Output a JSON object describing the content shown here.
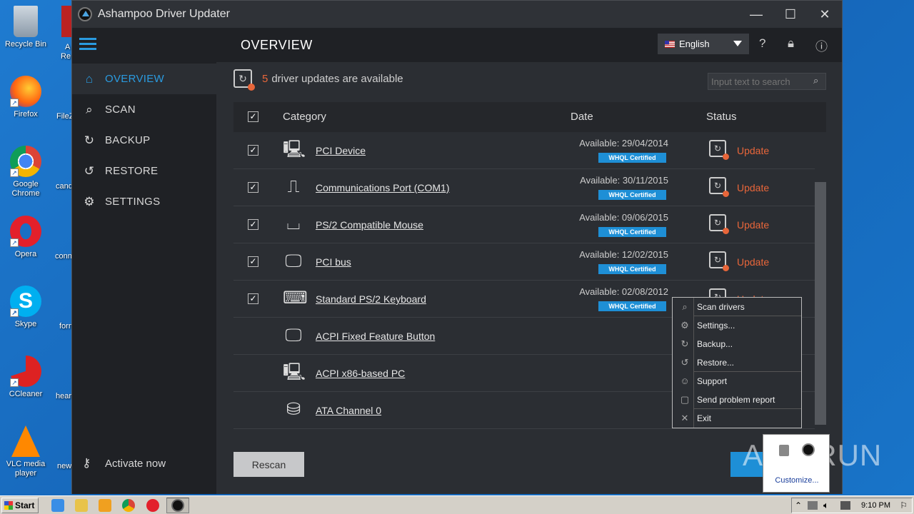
{
  "window": {
    "title": "Ashampoo Driver Updater",
    "minimize": "—",
    "maximize": "☐",
    "close": "✕"
  },
  "sidebar": {
    "items": [
      {
        "label": "OVERVIEW",
        "icon": "home-icon"
      },
      {
        "label": "SCAN",
        "icon": "search-icon"
      },
      {
        "label": "BACKUP",
        "icon": "backup-icon"
      },
      {
        "label": "RESTORE",
        "icon": "restore-icon"
      },
      {
        "label": "SETTINGS",
        "icon": "gear-icon"
      }
    ],
    "activate_label": "Activate now"
  },
  "header": {
    "page_title": "OVERVIEW",
    "language": "English"
  },
  "info": {
    "count": "5",
    "message": "driver updates are available",
    "search_placeholder": "Input text to search"
  },
  "table": {
    "columns": {
      "category": "Category",
      "date": "Date",
      "status": "Status"
    },
    "rows": [
      {
        "name": "PCI Device",
        "icon": "pc-tower-icon",
        "available": "Available: 29/04/2014",
        "badge": "WHQL Certified",
        "status": "Update",
        "checked": true
      },
      {
        "name": "Communications Port (COM1)",
        "icon": "usb-icon",
        "available": "Available: 30/11/2015",
        "badge": "WHQL Certified",
        "status": "Update",
        "checked": true
      },
      {
        "name": "PS/2 Compatible Mouse",
        "icon": "mouse-icon",
        "available": "Available: 09/06/2015",
        "badge": "WHQL Certified",
        "status": "Update",
        "checked": true
      },
      {
        "name": "PCI bus",
        "icon": "monitor-icon",
        "available": "Available: 12/02/2015",
        "badge": "WHQL Certified",
        "status": "Update",
        "checked": true
      },
      {
        "name": "Standard PS/2 Keyboard",
        "icon": "keyboard-icon",
        "available": "Available: 02/08/2012",
        "badge": "WHQL Certified",
        "status": "Update",
        "checked": true
      },
      {
        "name": "ACPI Fixed Feature Button",
        "icon": "monitor-icon",
        "available": "",
        "badge": "",
        "status": "",
        "checked": false
      },
      {
        "name": "ACPI x86-based PC",
        "icon": "pc-tower-icon",
        "available": "",
        "badge": "",
        "status": "",
        "checked": false
      },
      {
        "name": "ATA Channel 0",
        "icon": "drive-icon",
        "available": "",
        "badge": "",
        "status": "",
        "checked": false
      }
    ]
  },
  "buttons": {
    "rescan": "Rescan"
  },
  "context_menu": {
    "items": [
      "Scan drivers",
      "Settings...",
      "Backup...",
      "Restore...",
      "Support",
      "Send problem report",
      "Exit"
    ]
  },
  "tray_popup": {
    "customize": "Customize..."
  },
  "watermark": "ANY RUN",
  "desktop": {
    "icons": [
      "Recycle Bin",
      "Firefox",
      "Google Chrome",
      "Opera",
      "Skype",
      "CCleaner",
      "VLC media player"
    ],
    "partial_labels": [
      "A",
      "Re",
      "FileZ",
      "cand",
      "conn",
      "forn",
      "hear",
      "new"
    ]
  },
  "taskbar": {
    "start": "Start",
    "clock": "9:10 PM"
  },
  "colors": {
    "accent": "#2a9be0",
    "update": "#e8663a",
    "whql": "#1e8fd6"
  }
}
